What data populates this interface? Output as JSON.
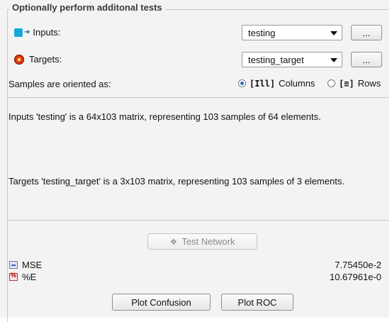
{
  "group": {
    "title": "Optionally perform additonal tests"
  },
  "inputs": {
    "label": "Inputs:",
    "value": "testing",
    "browse_label": "..."
  },
  "targets": {
    "label": "Targets:",
    "value": "testing_target",
    "browse_label": "..."
  },
  "orientation": {
    "label": "Samples are oriented as:",
    "columns_label": "Columns",
    "rows_label": "Rows",
    "columns_icon": "[Ill]",
    "rows_icon": "[≡]",
    "selected": "Columns"
  },
  "info": {
    "inputs_text": "Inputs 'testing'  is a 64x103 matrix, representing 103 samples of 64 elements.",
    "targets_text": "Targets 'testing_target'  is a 3x103 matrix, representing 103 samples of 3 elements."
  },
  "test_network": {
    "label": "Test Network"
  },
  "metrics": [
    {
      "name": "MSE",
      "value": "7.75450e-2",
      "icon": "mse-icon"
    },
    {
      "name": "%E",
      "value": "10.67961e-0",
      "icon": "percent-error-icon"
    }
  ],
  "buttons": {
    "plot_confusion": "Plot Confusion",
    "plot_roc": "Plot ROC"
  }
}
